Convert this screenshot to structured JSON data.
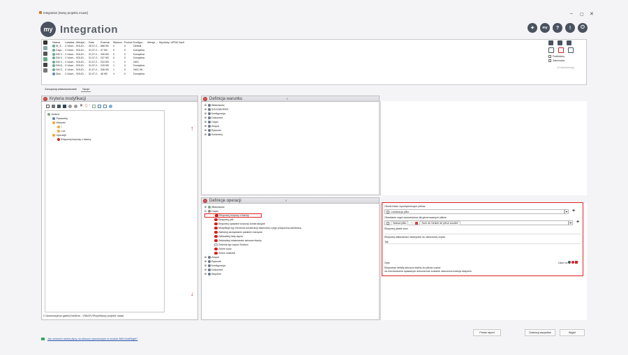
{
  "window": {
    "title": "Integration [Nowy projekt1.mcast]",
    "controls": [
      "–",
      "▢",
      "✕"
    ]
  },
  "brand": {
    "logo": "my",
    "name": "Integration"
  },
  "top_icons": [
    "?",
    "!",
    "⏻"
  ],
  "file_table": {
    "headers": [
      "Nazwa",
      "Lokaliza...",
      "Wersja/...",
      "Data",
      "Rozmiar",
      "Wyskon...",
      "Poziom",
      "Konfigur...",
      "Wersja ...",
      "Wyzdoby...",
      "ePDM Vault"
    ],
    "rows": [
      [
        "W_3...",
        "C:\\User...",
        "SOLID...",
        "26.07.2...",
        "688 KB",
        "0",
        "0",
        "Default...",
        "",
        "",
        ""
      ],
      [
        "Częś...",
        "C:\\User...",
        "SOLID...",
        "31.07.2...",
        "47 KB",
        "0",
        "0",
        "Domyślna",
        "",
        "",
        ""
      ],
      [
        "DM 3...",
        "C:\\User...",
        "SOLID...",
        "31.07.2...",
        "299 KB",
        "0",
        "0",
        "Domyślna",
        "",
        "",
        ""
      ],
      [
        "DM 3...",
        "C:\\User...",
        "SOLID...",
        "31.07.2...",
        "247 KB",
        "0",
        "0",
        "Domyślna",
        "",
        "",
        ""
      ],
      [
        "DM 3...",
        "C:\\User...",
        "SOLID...",
        "31.07.2...",
        "224 KB",
        "1",
        "0",
        "2601",
        "",
        "",
        ""
      ],
      [
        "DM-5...",
        "C:\\User...",
        "SOLID...",
        "31.07.2...",
        "215 KB",
        "1",
        "0",
        "Domyślna",
        "",
        "",
        ""
      ],
      [
        "DM 3...",
        "C:\\User...",
        "SOLID...",
        "31.07.2...",
        "336 KB",
        "1",
        "0",
        "2601 06...",
        "",
        "",
        ""
      ],
      [
        "Złoż...",
        "C:\\User...",
        "SOLID...",
        "31.07.2...",
        "46 KB",
        "4",
        "0",
        "Domyślna",
        "",
        "",
        ""
      ]
    ]
  },
  "right_side": {
    "checkboxes": [
      "Podfoldery",
      "Zależności"
    ],
    "count_label": "13 dokument(y)"
  },
  "tabs": [
    "Zarządzaj właściwościami",
    "Opcje"
  ],
  "left_panel": {
    "title": "Kryteria modyfikacji",
    "tree": [
      {
        "label": "Action1",
        "level": 0
      },
      {
        "label": "Parametry",
        "level": 1
      },
      {
        "label": "Warunki",
        "level": 1
      },
      {
        "label": "I",
        "level": 2
      },
      {
        "label": "Lub",
        "level": 2
      },
      {
        "label": "Operacje",
        "level": 1
      },
      {
        "label": "Eksportuj korpusy z blachy",
        "level": 2
      }
    ],
    "path": "C:\\Users\\szymon.gaels\\OneDrive - VISIATIV\\Pulpit\\Nowy projekt1.mcast"
  },
  "conditions_panel": {
    "title": "Definicja warunku",
    "items": [
      "Właściwość",
      "SOLIDWORKS",
      "Konfiguracja",
      "Dokument",
      "Część",
      "Zespół",
      "Rysunek",
      "Konkretny"
    ]
  },
  "operations_panel": {
    "title": "Definicje operacji",
    "groups": [
      "Właściwość",
      "Część"
    ],
    "items": [
      "Eksportuj korpusy z blachy",
      "Eksportuj plik",
      "Eksportuj spawane korpusy konstrukcyjne",
      "Modyfikuje typ elementu konstrukcji blachowej z jego połączoną warstwicą",
      "Zablokuj zarządzanie paskiem narzędzi",
      "Zaktualizuj listę cięcia",
      "Zaktualizuj właściwości arkusza blachy",
      "Zmienia typ części Toolbox",
      "Zmień kolor",
      "Zmień materiał"
    ],
    "tail": [
      "Zespół",
      "Rysunek",
      "Konfiguracja",
      "Dokument",
      "Wspólne"
    ]
  },
  "operation_detail": {
    "folder_label": "Określ folder wyodrębnionych plików",
    "folder_field": "Lokalizacja pliku",
    "rule_label": "Określanie reguł nazewnictwa dla generowanych plików",
    "rule_field1": "Nazwa pliku",
    "rule_field2": "Nom de l'article de pièce soudée",
    "flat_label": "Eksportuj płaski wzór",
    "props_label": "Eksportuj właściwości nadrzędne do utworzonej części",
    "props_value": "Tak",
    "opis_label": "Opis",
    "usun_label": "Usuń na",
    "opis_text1": "Eksportuje detaliy arkusza blachy do plików części",
    "opis_text2": "na mechanicznie spawanym dokumencie zostanie utworzona funkcja eksportu"
  },
  "bottom_buttons": [
    "Pokaż raport",
    "Zastosuj wszystkie",
    "Wyjdź"
  ],
  "footer_link": "Jak umieścić widok płyny na arkuszu rysunkowym w module BIM DraftSight?"
}
